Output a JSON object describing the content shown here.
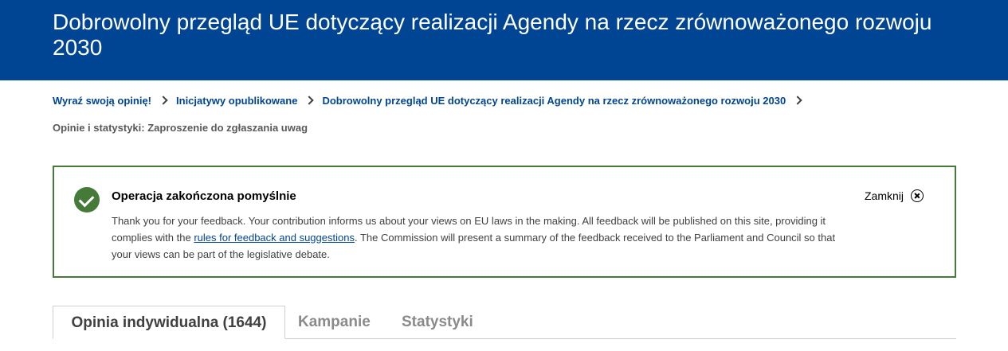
{
  "header": {
    "title": "Dobrowolny przegląd UE dotyczący realizacji Agendy na rzecz zrównoważonego rozwoju 2030"
  },
  "breadcrumb": {
    "items": [
      {
        "label": "Wyraź swoją opinię!"
      },
      {
        "label": "Inicjatywy opublikowane"
      },
      {
        "label": "Dobrowolny przegląd UE dotyczący realizacji Agendy na rzecz zrównoważonego rozwoju 2030"
      }
    ]
  },
  "subtitle": "Opinie i statystyki: Zaproszenie do zgłaszania uwag",
  "alert": {
    "title": "Operacja zakończona pomyślnie",
    "text_before": "Thank you for your feedback. Your contribution informs us about your views on EU laws in the making. All feedback will be published on this site, providing it complies with the ",
    "link": "rules for feedback and suggestions",
    "text_after": ". The Commission will present a summary of the feedback received to the Parliament and Council so that your views can be part of the legislative debate.",
    "close_label": "Zamknij",
    "close_icon": "close-circle-icon",
    "status_icon": "check-circle-icon",
    "status_color": "#467a39"
  },
  "tabs": [
    {
      "label": "Opinia indywidualna (1644)",
      "active": true
    },
    {
      "label": "Kampanie",
      "active": false
    },
    {
      "label": "Statystyki",
      "active": false
    }
  ],
  "colors": {
    "brand": "#004494",
    "success": "#467a39"
  }
}
